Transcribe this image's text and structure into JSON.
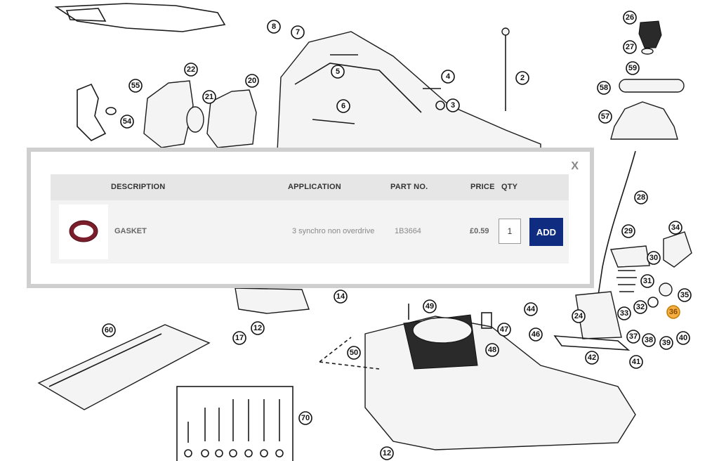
{
  "diagram": {
    "callouts": [
      "26",
      "27",
      "59",
      "58",
      "57",
      "8",
      "7",
      "5",
      "4",
      "3",
      "2",
      "6",
      "22",
      "55",
      "54",
      "21",
      "20",
      "28",
      "29",
      "30",
      "34",
      "31",
      "35",
      "36",
      "32",
      "33",
      "44",
      "46",
      "24",
      "14",
      "12",
      "17",
      "60",
      "49",
      "47",
      "48",
      "50",
      "42",
      "37",
      "38",
      "39",
      "40",
      "41",
      "70",
      "12"
    ],
    "highlighted": "36"
  },
  "popup": {
    "close_label": "X",
    "columns": {
      "description": "DESCRIPTION",
      "application": "APPLICATION",
      "part_no": "PART NO.",
      "price": "PRICE",
      "qty": "QTY"
    },
    "item": {
      "description": "GASKET",
      "application": "3 synchro non overdrive",
      "part_no": "1B3664",
      "price": "£0.59",
      "qty": "1",
      "add_label": "ADD",
      "thumbnail_color": "#7a1e2b"
    },
    "add_button_color": "#0f2c80"
  }
}
